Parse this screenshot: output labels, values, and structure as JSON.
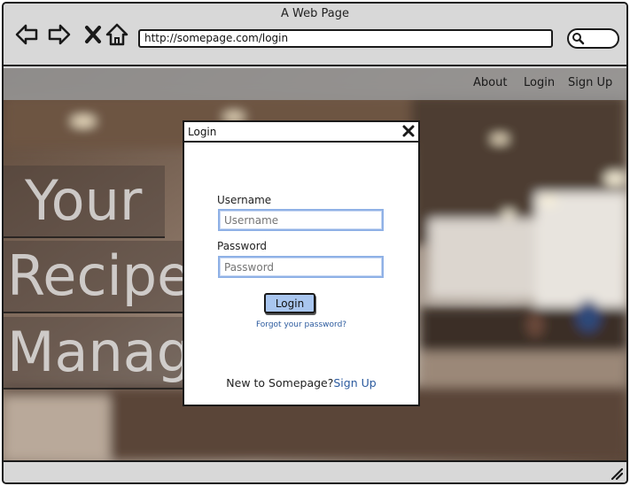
{
  "window": {
    "title": "A Web Page"
  },
  "browser": {
    "url": "http://somepage.com/login",
    "icons": [
      "back-arrow-icon",
      "forward-arrow-icon",
      "stop-icon",
      "home-icon",
      "search-icon"
    ]
  },
  "nav": {
    "about": "About",
    "login": "Login",
    "signup": "Sign Up"
  },
  "hero": {
    "line1": "Your",
    "line2": "Recipe",
    "line3": "Manag"
  },
  "modal": {
    "title": "Login",
    "username_label": "Username",
    "username_placeholder": "Username",
    "password_label": "Password",
    "password_placeholder": "Password",
    "login_button": "Login",
    "forgot_link": "Forgot your password?",
    "signup_prompt": "New to Somepage?",
    "signup_link": "Sign Up"
  },
  "colors": {
    "accent": "#a9c6ef",
    "input_border": "#8fb1e6",
    "link": "#2b5a9e",
    "chrome": "#d8d8d8"
  }
}
